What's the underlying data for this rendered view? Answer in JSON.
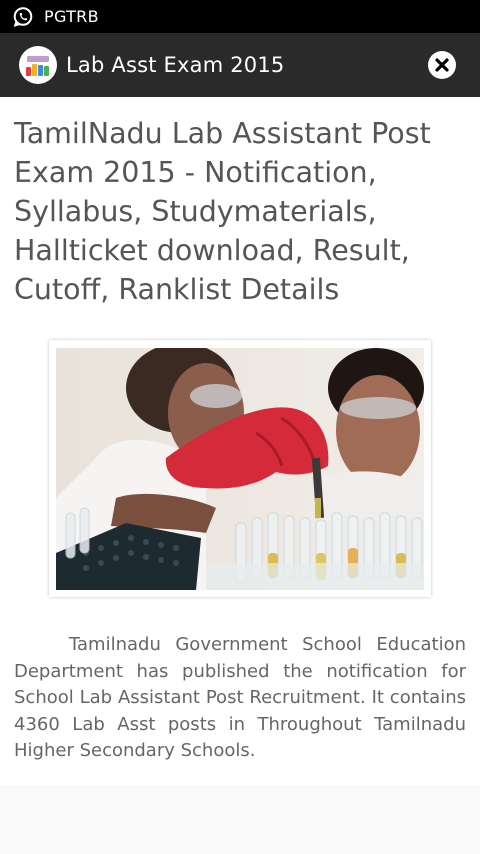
{
  "status_bar": {
    "app_name": "PGTRB",
    "icon": "whatsapp-icon"
  },
  "app_bar": {
    "title": "Lab Asst Exam 2015",
    "logo": "lab-flasks-logo",
    "close_icon": "close-icon",
    "background": "#2a2a2a"
  },
  "article": {
    "title": "TamilNadu Lab Assistant Post Exam 2015 - Notification, Syllabus, Studymaterials, Hallticket download, Result, Cutoff, Ranklist Details",
    "image": "lab-scientists-test-tubes-photo",
    "body": "Tamilnadu Government School Education Department has published the notification for School Lab Assistant Post Recruitment. It contains 4360 Lab Asst posts in Throughout Tamilnadu Higher Secondary Schools."
  },
  "colors": {
    "status_bar": "#000000",
    "title_text": "#555555",
    "body_text": "#666666",
    "glove": "#d42a3a"
  }
}
